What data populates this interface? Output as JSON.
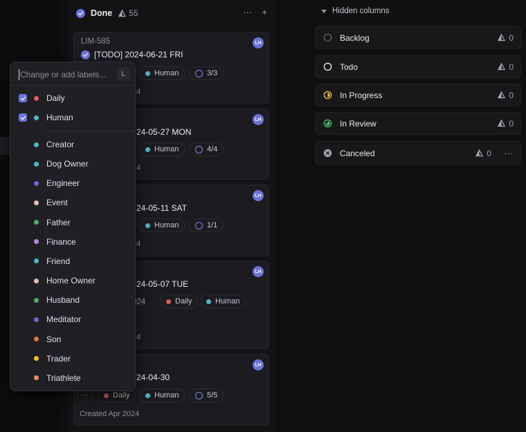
{
  "colors": {
    "accent": "#6b74e0",
    "red": "#e05c5c",
    "teal": "#4fb8c9",
    "purple": "#7064d6",
    "pink": "#f0b8b8",
    "green": "#58a86a",
    "lilac": "#b48ae0",
    "orange": "#e07c3c",
    "yellow": "#f0c030",
    "salmon": "#ea8c5c"
  },
  "column": {
    "title": "Done",
    "count": "55",
    "icon": "done-circle-icon"
  },
  "cards": [
    {
      "id": "LIM-585",
      "avatar": "LH",
      "title": "[TODO] 2024-06-21 FRI",
      "labels": [
        "Human"
      ],
      "progress": "3/3",
      "meta": "24"
    },
    {
      "avatar": "LH",
      "title": "24-05-27 MON",
      "labels": [
        "Human"
      ],
      "progress": "4/4",
      "meta": "24"
    },
    {
      "avatar": "LH",
      "title": "24-05-11 SAT",
      "labels": [
        "Human"
      ],
      "progress": "1/1",
      "meta": "24"
    },
    {
      "avatar": "LH",
      "title": "24-05-07 TUE",
      "extra": "024",
      "labels": [
        "Daily",
        "Human"
      ],
      "meta": "24"
    },
    {
      "avatar": "LH",
      "title": "24-04-30",
      "more": "···",
      "labels": [
        "Daily",
        "Human"
      ],
      "progress": "5/5",
      "meta": "Created Apr 2024"
    }
  ],
  "hidden": {
    "heading": "Hidden columns",
    "columns": [
      {
        "label": "Backlog",
        "count": "0",
        "icon": "backlog-dashed-circle-icon"
      },
      {
        "label": "Todo",
        "count": "0",
        "icon": "todo-circle-icon"
      },
      {
        "label": "In Progress",
        "count": "0",
        "icon": "in-progress-half-circle-icon"
      },
      {
        "label": "In Review",
        "count": "0",
        "icon": "in-review-circle-icon"
      },
      {
        "label": "Canceled",
        "count": "0",
        "icon": "canceled-x-circle-icon",
        "more": "···"
      }
    ]
  },
  "label_menu": {
    "placeholder": "Change or add labels...",
    "shortcut": "L",
    "selected": [
      {
        "label": "Daily",
        "color": "#e05c5c"
      },
      {
        "label": "Human",
        "color": "#4fb8c9"
      }
    ],
    "options": [
      {
        "label": "Creator",
        "color": "#4fb8c9"
      },
      {
        "label": "Dog Owner",
        "color": "#4fb8c9"
      },
      {
        "label": "Engineer",
        "color": "#7064d6"
      },
      {
        "label": "Event",
        "color": "#f0b8b8"
      },
      {
        "label": "Father",
        "color": "#58a86a"
      },
      {
        "label": "Finance",
        "color": "#b48ae0"
      },
      {
        "label": "Friend",
        "color": "#4fb8c9"
      },
      {
        "label": "Home Owner",
        "color": "#f0b8b8"
      },
      {
        "label": "Husband",
        "color": "#58a86a"
      },
      {
        "label": "Meditator",
        "color": "#7064d6"
      },
      {
        "label": "Son",
        "color": "#e07c3c"
      },
      {
        "label": "Trader",
        "color": "#f0c030"
      },
      {
        "label": "Triathlete",
        "color": "#ea8c5c"
      }
    ]
  }
}
